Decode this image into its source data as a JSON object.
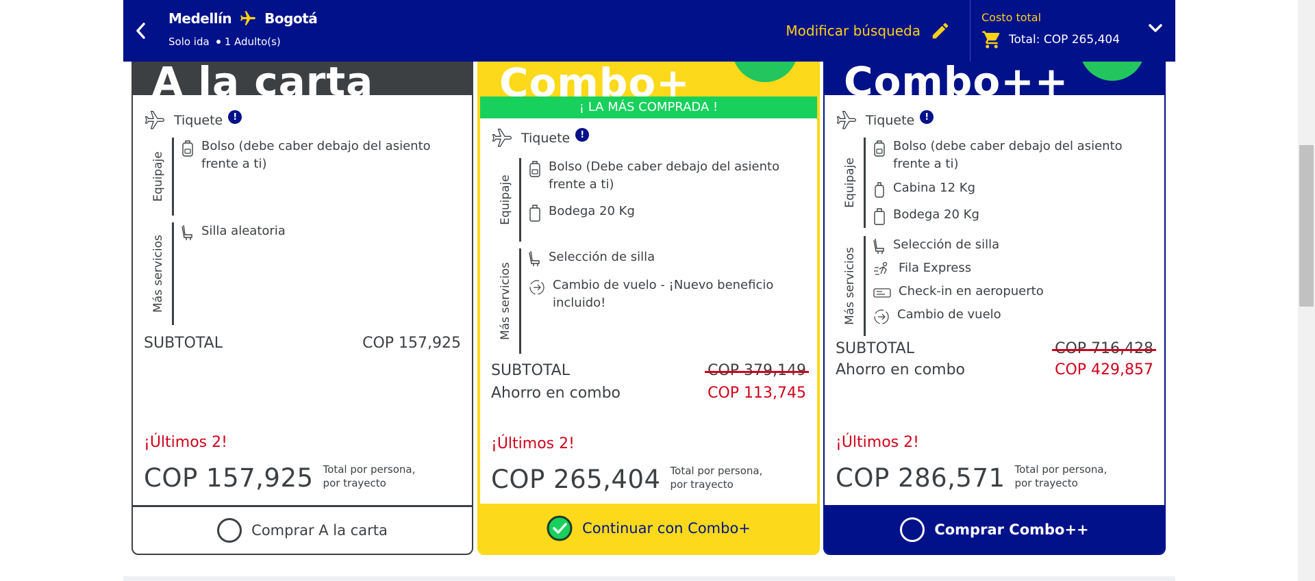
{
  "header": {
    "origin": "Medellín",
    "destination": "Bogotá",
    "trip_type": "Solo ida",
    "passengers": "1 Adulto(s)",
    "modify_label": "Modificar búsqueda",
    "total_label": "Costo total",
    "total_value": "Total: COP 265,404",
    "accent_color": "#fcd116",
    "bar_color": "#00118a"
  },
  "cards": [
    {
      "brand": "A la carta",
      "ticket": "Tiquete",
      "baggage_label": "Equipaje",
      "baggage": [
        "Bolso (debe caber debajo del asiento frente a ti)"
      ],
      "services_label": "Más servicios",
      "services": [
        "Silla aleatoria"
      ],
      "subtotal_label": "SUBTOTAL",
      "subtotal": "COP 157,925",
      "availability": "¡Últimos 2!",
      "price": "COP 157,925",
      "per_person_1": "Total por persona,",
      "per_person_2": "por trayecto",
      "cta": "Comprar A la carta",
      "selected": false
    },
    {
      "brand": "Combo+",
      "banner": "¡ LA MÁS COMPRADA !",
      "ticket": "Tiquete",
      "baggage_label": "Equipaje",
      "baggage": [
        "Bolso (Debe caber debajo del asiento frente a ti)",
        "Bodega 20 Kg"
      ],
      "services_label": "Más servicios",
      "services": [
        "Selección de silla",
        "Cambio de vuelo - ¡Nuevo beneficio incluido!"
      ],
      "subtotal_label": "SUBTOTAL",
      "subtotal_strike": "COP 379,149",
      "savings_label": "Ahorro en combo",
      "savings": "COP 113,745",
      "availability": "¡Últimos 2!",
      "price": "COP 265,404",
      "per_person_1": "Total por persona,",
      "per_person_2": "por trayecto",
      "cta": "Continuar con Combo+",
      "selected": true
    },
    {
      "brand": "Combo++",
      "ticket": "Tiquete",
      "baggage_label": "Equipaje",
      "baggage": [
        "Bolso (debe caber debajo del asiento frente a ti)",
        "Cabina 12 Kg",
        "Bodega 20 Kg"
      ],
      "services_label": "Más servicios",
      "services": [
        "Selección de silla",
        "Fila Express",
        "Check-in en aeropuerto",
        "Cambio de vuelo"
      ],
      "subtotal_label": "SUBTOTAL",
      "subtotal_strike": "COP 716,428",
      "savings_label": "Ahorro en combo",
      "savings": "COP 429,857",
      "availability": "¡Últimos 2!",
      "price": "COP 286,571",
      "per_person_1": "Total por persona,",
      "per_person_2": "por trayecto",
      "cta": "Comprar Combo++",
      "selected": false
    }
  ]
}
